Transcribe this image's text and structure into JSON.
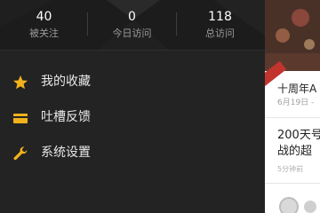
{
  "drawer": {
    "stats": [
      {
        "value": "40",
        "label": "被关注"
      },
      {
        "value": "0",
        "label": "今日访问"
      },
      {
        "value": "118",
        "label": "总访问"
      }
    ],
    "menu": [
      {
        "label": "我的收藏",
        "icon": "star-icon",
        "color": "#f2b21c"
      },
      {
        "label": "吐槽反馈",
        "icon": "envelope-icon",
        "color": "#f2b21c"
      },
      {
        "label": "系统设置",
        "icon": "wrench-icon",
        "color": "#f2b21c"
      }
    ]
  },
  "content": {
    "card_title": "十周年A",
    "card_sub": "6月19日 -",
    "article_title_line1": "200天号",
    "article_title_line2": "战的超",
    "article_time": "5分钟前"
  },
  "colors": {
    "drawer_bg": "#232323",
    "accent": "#f2b21c",
    "badge": "#c2352f"
  }
}
